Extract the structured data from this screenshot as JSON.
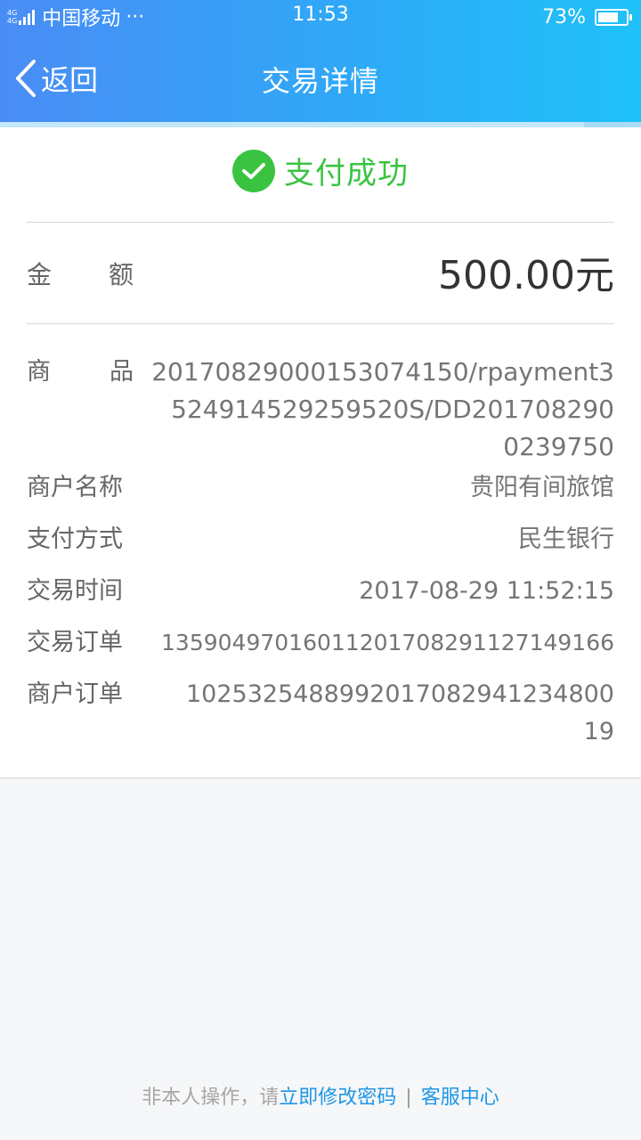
{
  "status_bar": {
    "network_tag_1": "4G",
    "network_tag_2": "4G",
    "carrier": "中国移动",
    "more": "···",
    "time": "11:53",
    "battery": "73%",
    "battery_level": 0.73
  },
  "nav": {
    "back_label": "返回",
    "title": "交易详情"
  },
  "result": {
    "status_text": "支付成功"
  },
  "amount": {
    "label_1": "金",
    "label_2": "额",
    "value": "500.00元"
  },
  "details": {
    "product_label_1": "商",
    "product_label_2": "品",
    "product_value_line1": "20170829000153074150/rpayment3",
    "product_value_line2": "524914529259520S/DD201708290",
    "product_value_line3": "0239750",
    "merchant_name_label": "商户名称",
    "merchant_name_value": "贵阳有间旅馆",
    "payment_method_label": "支付方式",
    "payment_method_value": "民生银行",
    "trade_time_label": "交易时间",
    "trade_time_value": "2017-08-29 11:52:15",
    "trade_order_label": "交易订单",
    "trade_order_value": "13590497016011201708291127149166",
    "merchant_order_label": "商户订单",
    "merchant_order_line1": "10253254889920170829412348​00",
    "merchant_order_line2": "19"
  },
  "footer": {
    "notice": "非本人操作，请",
    "change_password": "立即修改密码",
    "separator": "|",
    "customer_service": "客服中心"
  },
  "colors": {
    "header_start": "#4a8cf5",
    "header_end": "#1fc1f8",
    "success_green": "#3ac341",
    "link_blue": "#2196e5"
  }
}
